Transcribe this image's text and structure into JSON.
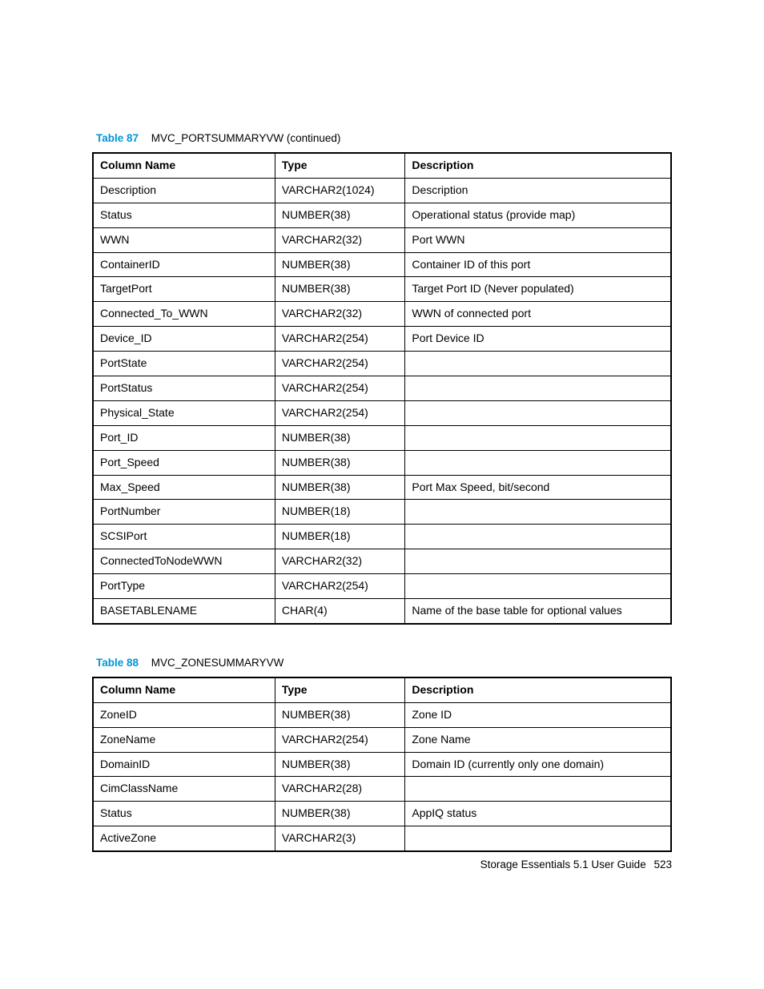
{
  "table87": {
    "labelPrefix": "Table 87",
    "title": "MVC_PORTSUMMARYVW (continued)",
    "headers": {
      "col1": "Column Name",
      "col2": "Type",
      "col3": "Description"
    },
    "rows": [
      {
        "c1": "Description",
        "c2": "VARCHAR2(1024)",
        "c3": "Description"
      },
      {
        "c1": "Status",
        "c2": "NUMBER(38)",
        "c3": "Operational status (provide map)"
      },
      {
        "c1": "WWN",
        "c2": "VARCHAR2(32)",
        "c3": "Port WWN"
      },
      {
        "c1": "ContainerID",
        "c2": "NUMBER(38)",
        "c3": "Container ID of this port"
      },
      {
        "c1": "TargetPort",
        "c2": "NUMBER(38)",
        "c3": "Target Port ID (Never populated)"
      },
      {
        "c1": "Connected_To_WWN",
        "c2": "VARCHAR2(32)",
        "c3": "WWN of connected port"
      },
      {
        "c1": "Device_ID",
        "c2": "VARCHAR2(254)",
        "c3": "Port Device ID"
      },
      {
        "c1": "PortState",
        "c2": "VARCHAR2(254)",
        "c3": ""
      },
      {
        "c1": "PortStatus",
        "c2": "VARCHAR2(254)",
        "c3": ""
      },
      {
        "c1": "Physical_State",
        "c2": "VARCHAR2(254)",
        "c3": ""
      },
      {
        "c1": "Port_ID",
        "c2": "NUMBER(38)",
        "c3": ""
      },
      {
        "c1": "Port_Speed",
        "c2": "NUMBER(38)",
        "c3": ""
      },
      {
        "c1": "Max_Speed",
        "c2": "NUMBER(38)",
        "c3": "Port Max Speed, bit/second"
      },
      {
        "c1": "PortNumber",
        "c2": "NUMBER(18)",
        "c3": ""
      },
      {
        "c1": "SCSIPort",
        "c2": "NUMBER(18)",
        "c3": ""
      },
      {
        "c1": "ConnectedToNodeWWN",
        "c2": "VARCHAR2(32)",
        "c3": ""
      },
      {
        "c1": "PortType",
        "c2": "VARCHAR2(254)",
        "c3": ""
      },
      {
        "c1": "BASETABLENAME",
        "c2": "CHAR(4)",
        "c3": "Name of the base table for optional values"
      }
    ]
  },
  "table88": {
    "labelPrefix": "Table 88",
    "title": "MVC_ZONESUMMARYVW",
    "headers": {
      "col1": "Column Name",
      "col2": "Type",
      "col3": "Description"
    },
    "rows": [
      {
        "c1": "ZoneID",
        "c2": "NUMBER(38)",
        "c3": "Zone ID"
      },
      {
        "c1": "ZoneName",
        "c2": "VARCHAR2(254)",
        "c3": "Zone Name"
      },
      {
        "c1": "DomainID",
        "c2": "NUMBER(38)",
        "c3": "Domain ID (currently only one domain)"
      },
      {
        "c1": "CimClassName",
        "c2": "VARCHAR2(28)",
        "c3": ""
      },
      {
        "c1": "Status",
        "c2": "NUMBER(38)",
        "c3": "AppIQ status"
      },
      {
        "c1": "ActiveZone",
        "c2": "VARCHAR2(3)",
        "c3": ""
      }
    ]
  },
  "footer": {
    "text": "Storage Essentials 5.1 User Guide",
    "page": "523"
  }
}
